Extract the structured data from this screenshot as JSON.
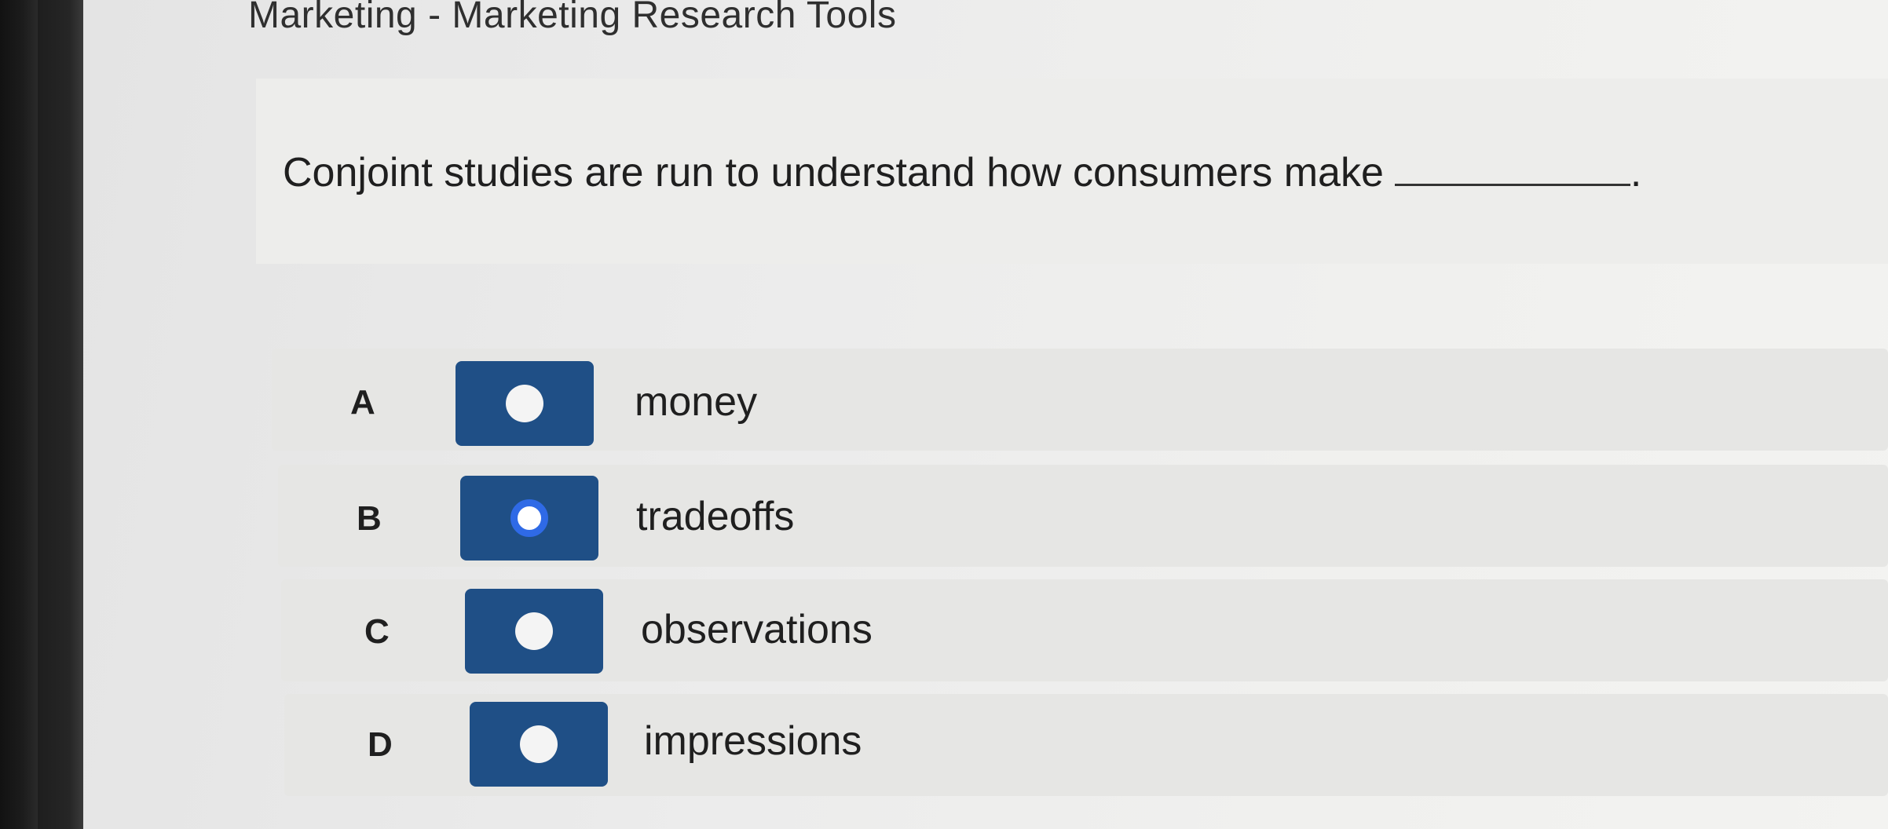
{
  "page": {
    "title": "Marketing - Marketing Research Tools"
  },
  "question": {
    "text": "Conjoint studies are run to understand how consumers make",
    "end_punct": "."
  },
  "options": [
    {
      "letter": "A",
      "text": "money",
      "selected": false
    },
    {
      "letter": "B",
      "text": "tradeoffs",
      "selected": true
    },
    {
      "letter": "C",
      "text": "observations",
      "selected": false
    },
    {
      "letter": "D",
      "text": "impressions",
      "selected": false
    }
  ],
  "colors": {
    "radio_box": "#1f4f86",
    "radio_selected_ring": "#2f6ae6"
  }
}
